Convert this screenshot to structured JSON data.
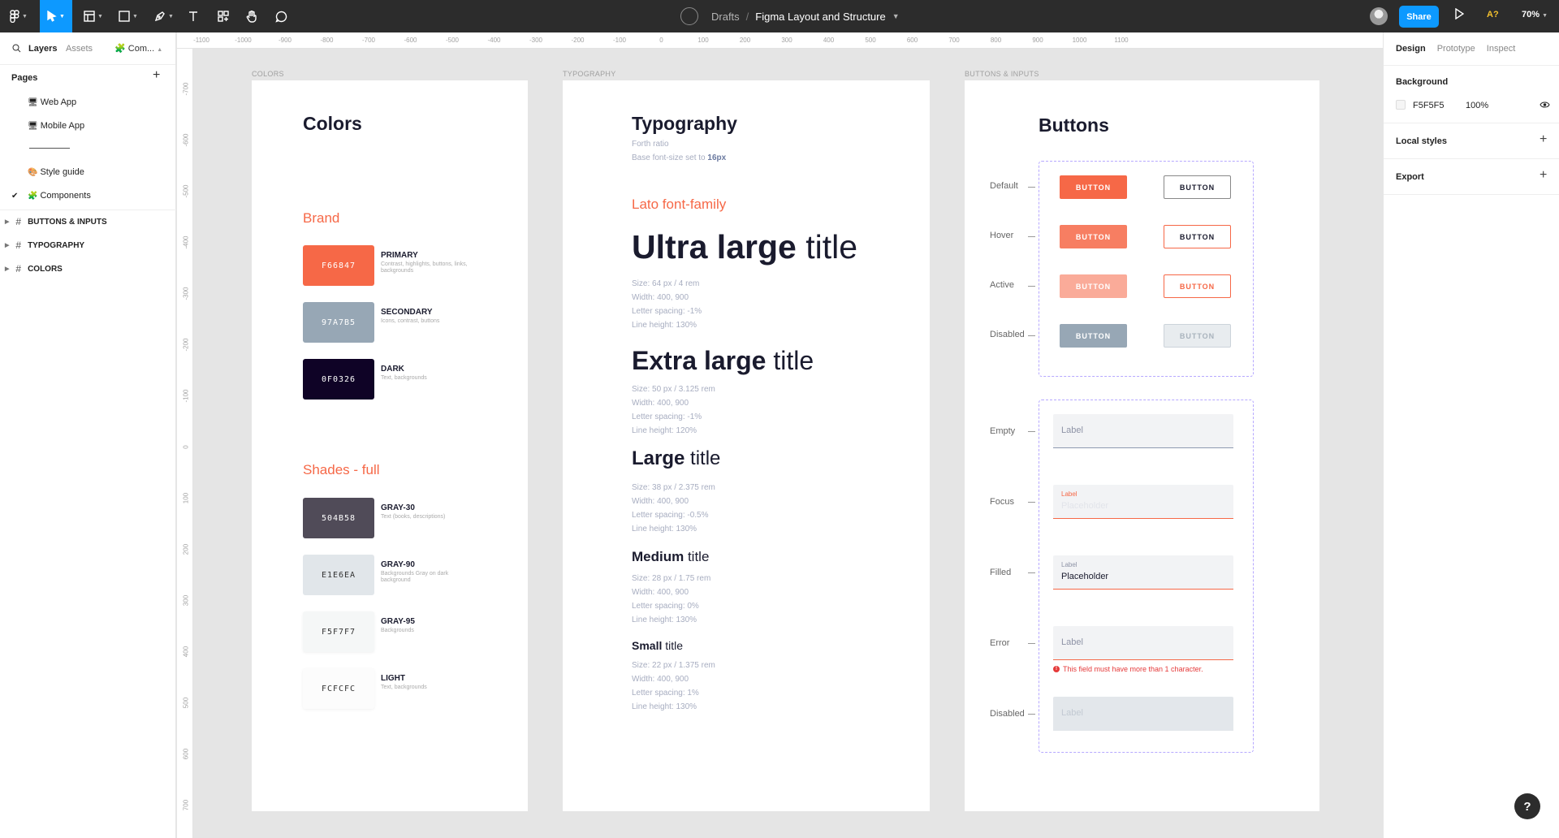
{
  "toolbar": {
    "breadcrumb_drafts": "Drafts",
    "breadcrumb_sep": "/",
    "file_name": "Figma Layout and Structure",
    "share_label": "Share",
    "badge": "A?",
    "zoom": "70%"
  },
  "left_panel": {
    "tabs": [
      "Layers",
      "Assets",
      "Com..."
    ],
    "pages_heading": "Pages",
    "pages": [
      {
        "label": "Web App",
        "icon": "🖥"
      },
      {
        "label": "Mobile App",
        "icon": "🖥"
      },
      {
        "label": "Style guide",
        "icon": "🎨"
      },
      {
        "label": "Components",
        "icon": "🧩",
        "checked": true
      }
    ],
    "layers": [
      "BUTTONS & INPUTS",
      "TYPOGRAPHY",
      "COLORS"
    ]
  },
  "rulers": {
    "h": [
      "-1100",
      "-1000",
      "-900",
      "-800",
      "-700",
      "-600",
      "-500",
      "-400",
      "-300",
      "-200",
      "-100",
      "0",
      "100",
      "200",
      "300",
      "400",
      "500",
      "600",
      "700",
      "800",
      "900",
      "1000",
      "1100"
    ],
    "v": [
      "-700",
      "-600",
      "-500",
      "-400",
      "-300",
      "-200",
      "-100",
      "0",
      "100",
      "200",
      "300",
      "400",
      "500",
      "600",
      "700"
    ]
  },
  "colors_frame": {
    "frame_label": "COLORS",
    "title": "Colors",
    "brand_heading": "Brand",
    "brand": [
      {
        "hex": "F66847",
        "name": "PRIMARY",
        "desc": "Contrast, highlights, buttons, links, backgrounds",
        "color": "#F66847",
        "text_color": "#ffffff"
      },
      {
        "hex": "97A7B5",
        "name": "SECONDARY",
        "desc": "Icons, contrast, buttons",
        "color": "#97A7B5",
        "text_color": "#ffffff"
      },
      {
        "hex": "0F0326",
        "name": "DARK",
        "desc": "Text, backgrounds",
        "color": "#0F0326",
        "text_color": "#ffffff"
      }
    ],
    "shades_heading": "Shades - full",
    "shades": [
      {
        "hex": "504B58",
        "name": "GRAY-30",
        "desc": "Text (books, descriptions)",
        "color": "#504B58",
        "text_color": "#ffffff"
      },
      {
        "hex": "E1E6EA",
        "name": "GRAY-90",
        "desc": "Backgrounds Gray on dark background",
        "color": "#E1E6EA",
        "text_color": "#333333"
      },
      {
        "hex": "F5F7F7",
        "name": "GRAY-95",
        "desc": "Backgrounds",
        "color": "#F5F7F7",
        "text_color": "#333333"
      },
      {
        "hex": "FCFCFC",
        "name": "LIGHT",
        "desc": "Text, backgrounds",
        "color": "#FCFCFC",
        "text_color": "#333333"
      }
    ]
  },
  "typography_frame": {
    "frame_label": "TYPOGRAPHY",
    "title": "Typography",
    "sub1": "Forth ratio",
    "sub2_prefix": "Base font-size set to ",
    "sub2_value": "16px",
    "family_heading": "Lato font-family",
    "styles": [
      {
        "bold": "Ultra large",
        "normal": " title",
        "specs": [
          "Size: 64 px / 4 rem",
          "Width: 400, 900",
          "Letter spacing: -1%",
          "Line height: 130%"
        ]
      },
      {
        "bold": "Extra large",
        "normal": " title",
        "specs": [
          "Size: 50 px / 3.125 rem",
          "Width: 400, 900",
          "Letter spacing: -1%",
          "Line height: 120%"
        ]
      },
      {
        "bold": "Large",
        "normal": " title",
        "specs": [
          "Size: 38 px / 2.375 rem",
          "Width: 400, 900",
          "Letter spacing: -0.5%",
          "Line height: 130%"
        ]
      },
      {
        "bold": "Medium",
        "normal": " title",
        "specs": [
          "Size: 28 px / 1.75 rem",
          "Width: 400, 900",
          "Letter spacing: 0%",
          "Line height: 130%"
        ]
      },
      {
        "bold": "Small",
        "normal": " title",
        "specs": [
          "Size: 22 px / 1.375 rem",
          "Width: 400, 900",
          "Letter spacing: 1%",
          "Line height: 130%"
        ]
      }
    ]
  },
  "buttons_frame": {
    "frame_label": "BUTTONS & INPUTS",
    "title": "Buttons",
    "button_states": [
      "Default",
      "Hover",
      "Active",
      "Disabled"
    ],
    "button_label": "BUTTON",
    "input_states": [
      "Empty",
      "Focus",
      "Filled",
      "Error",
      "Disabled"
    ],
    "input_label": "Label",
    "input_placeholder": "Placeholder",
    "error_message": "This field must have more than 1 character.",
    "colors": {
      "primary": "#F66847",
      "disabled": "#97A7B5",
      "dashed": "#B6A8FF"
    }
  },
  "right_panel": {
    "tabs": [
      "Design",
      "Prototype",
      "Inspect"
    ],
    "background_heading": "Background",
    "background_hex": "F5F5F5",
    "background_opacity": "100%",
    "local_styles": "Local styles",
    "export": "Export"
  },
  "help_label": "?"
}
